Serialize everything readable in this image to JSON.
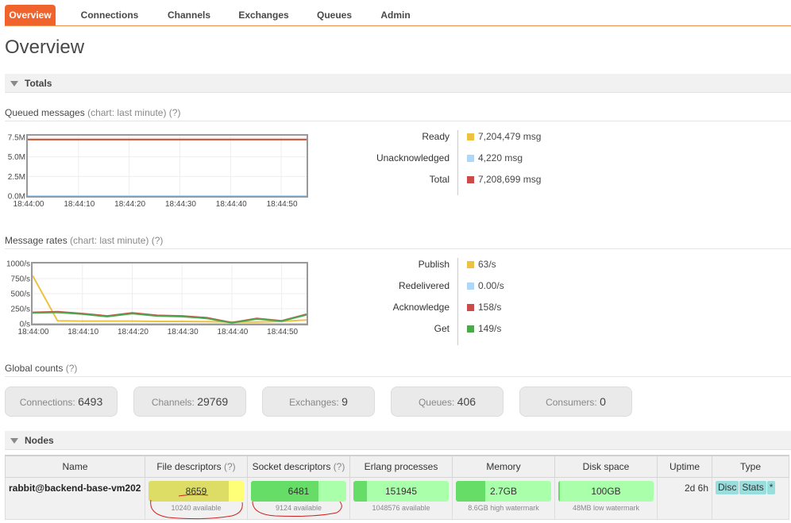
{
  "nav": {
    "tabs": [
      {
        "label": "Overview",
        "active": true
      },
      {
        "label": "Connections"
      },
      {
        "label": "Channels"
      },
      {
        "label": "Exchanges"
      },
      {
        "label": "Queues"
      },
      {
        "label": "Admin"
      }
    ]
  },
  "page_title": "Overview",
  "totals_section": {
    "label": "Totals"
  },
  "queued_messages": {
    "title": "Queued messages",
    "hint": "(chart: last minute) (?)",
    "legend": [
      {
        "label": "Ready",
        "value": "7,204,479 msg",
        "color": "#edc240"
      },
      {
        "label": "Unacknowledged",
        "value": "4,220 msg",
        "color": "#afd8f8"
      },
      {
        "label": "Total",
        "value": "7,208,699 msg",
        "color": "#cb4b4b"
      }
    ]
  },
  "message_rates": {
    "title": "Message rates",
    "hint": "(chart: last minute) (?)",
    "legend": [
      {
        "label": "Publish",
        "value": "63/s",
        "color": "#edc240"
      },
      {
        "label": "Redelivered",
        "value": "0.00/s",
        "color": "#afd8f8"
      },
      {
        "label": "Acknowledge",
        "value": "158/s",
        "color": "#cb4b4b"
      },
      {
        "label": "Get",
        "value": "149/s",
        "color": "#4da74d"
      }
    ]
  },
  "chart_data": [
    {
      "type": "line",
      "x_tick_labels": [
        "18:44:00",
        "18:44:10",
        "18:44:20",
        "18:44:30",
        "18:44:40",
        "18:44:50"
      ],
      "y_tick_labels": [
        "0.0M",
        "2.5M",
        "5.0M",
        "7.5M"
      ],
      "y_ticks": [
        0,
        2.5,
        5.0,
        7.5
      ],
      "ylim": [
        0,
        7.7
      ],
      "xlim": [
        0,
        55
      ],
      "grid": true,
      "series": [
        {
          "name": "Ready",
          "color": "#edc240",
          "x": [
            0,
            55
          ],
          "y": [
            7.2,
            7.2
          ]
        },
        {
          "name": "Unacknowledged",
          "color": "#afd8f8",
          "x": [
            0,
            55
          ],
          "y": [
            0.0042,
            0.0042
          ]
        },
        {
          "name": "Total",
          "color": "#cb4b4b",
          "x": [
            0,
            55
          ],
          "y": [
            7.21,
            7.21
          ]
        }
      ]
    },
    {
      "type": "line",
      "x_tick_labels": [
        "18:44:00",
        "18:44:10",
        "18:44:20",
        "18:44:30",
        "18:44:40",
        "18:44:50"
      ],
      "y_tick_labels": [
        "0/s",
        "250/s",
        "500/s",
        "750/s",
        "1000/s"
      ],
      "y_ticks": [
        0,
        250,
        500,
        750,
        1000
      ],
      "ylim": [
        0,
        1000
      ],
      "xlim": [
        0,
        55
      ],
      "grid": true,
      "series": [
        {
          "name": "Publish",
          "color": "#edc240",
          "x": [
            0,
            5,
            10,
            15,
            20,
            25,
            30,
            35,
            40,
            45,
            50,
            55
          ],
          "y": [
            800,
            50,
            45,
            45,
            45,
            40,
            40,
            35,
            30,
            30,
            40,
            63
          ]
        },
        {
          "name": "Redelivered",
          "color": "#afd8f8",
          "x": [
            0,
            55
          ],
          "y": [
            0,
            0
          ]
        },
        {
          "name": "Acknowledge",
          "color": "#cb4b4b",
          "x": [
            0,
            5,
            10,
            15,
            20,
            25,
            30,
            35,
            40,
            45,
            50,
            55
          ],
          "y": [
            190,
            200,
            170,
            130,
            180,
            140,
            130,
            100,
            20,
            90,
            50,
            158
          ]
        },
        {
          "name": "Get",
          "color": "#4da74d",
          "x": [
            0,
            5,
            10,
            15,
            20,
            25,
            30,
            35,
            40,
            45,
            50,
            55
          ],
          "y": [
            180,
            190,
            160,
            120,
            170,
            130,
            120,
            90,
            15,
            80,
            45,
            149
          ]
        }
      ]
    }
  ],
  "global_counts": {
    "title": "Global counts",
    "hint": "(?)",
    "items": [
      {
        "label": "Connections:",
        "value": "6493"
      },
      {
        "label": "Channels:",
        "value": "29769"
      },
      {
        "label": "Exchanges:",
        "value": "9"
      },
      {
        "label": "Queues:",
        "value": "406"
      },
      {
        "label": "Consumers:",
        "value": "0"
      }
    ]
  },
  "nodes_section": {
    "label": "Nodes"
  },
  "nodes_table": {
    "headers": {
      "name": "Name",
      "fd": "File descriptors",
      "fd_hint": "(?)",
      "sd": "Socket descriptors",
      "sd_hint": "(?)",
      "erlang": "Erlang processes",
      "memory": "Memory",
      "disk": "Disk space",
      "uptime": "Uptime",
      "type": "Type"
    },
    "row": {
      "name": "rabbit@backend-base-vm202",
      "fd": {
        "value": "8659",
        "sub": "10240 available",
        "fraction": 0.845,
        "fill_color": "#dddd66",
        "bg_color": "#ffff77"
      },
      "sd": {
        "value": "6481",
        "sub": "9124 available",
        "fraction": 0.71,
        "fill_color": "#66dd66",
        "bg_color": "#aaffaa"
      },
      "erlang": {
        "value": "151945",
        "sub": "1048576 available",
        "fraction": 0.145,
        "fill_color": "#66dd66",
        "bg_color": "#aaffaa"
      },
      "memory": {
        "value": "2.7GB",
        "sub": "8.6GB high watermark",
        "fraction": 0.31,
        "fill_color": "#66dd66",
        "bg_color": "#aaffaa"
      },
      "disk": {
        "value": "100GB",
        "sub": "48MB low watermark",
        "fraction": 0.02,
        "fill_color": "#66dd66",
        "bg_color": "#aaffaa"
      },
      "uptime": "2d 6h",
      "types": [
        "Disc",
        "Stats",
        "*"
      ]
    }
  },
  "annotation_color": "#cc2222"
}
